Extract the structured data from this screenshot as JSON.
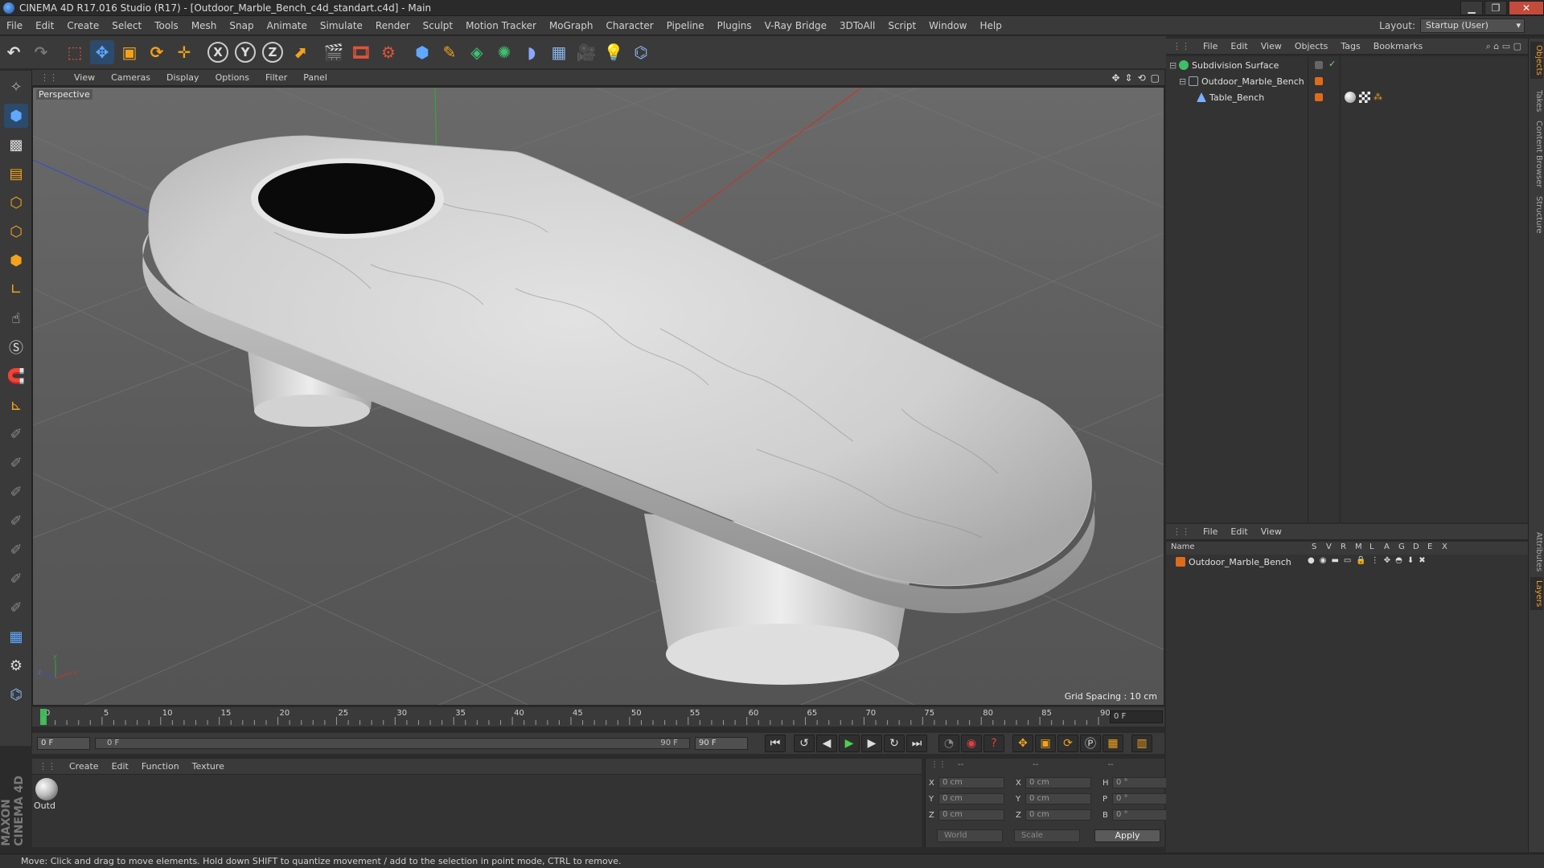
{
  "window": {
    "title": "CINEMA 4D R17.016 Studio (R17) - [Outdoor_Marble_Bench_c4d_standart.c4d] - Main"
  },
  "menubar": [
    "File",
    "Edit",
    "Create",
    "Select",
    "Tools",
    "Mesh",
    "Snap",
    "Animate",
    "Simulate",
    "Render",
    "Sculpt",
    "Motion Tracker",
    "MoGraph",
    "Character",
    "Pipeline",
    "Plugins",
    "V-Ray Bridge",
    "3DToAll",
    "Script",
    "Window",
    "Help"
  ],
  "layout": {
    "label": "Layout:",
    "value": "Startup (User)"
  },
  "toolbar": {
    "axis_x": "X",
    "axis_y": "Y",
    "axis_z": "Z"
  },
  "viewport": {
    "menu": [
      "View",
      "Cameras",
      "Display",
      "Options",
      "Filter",
      "Panel"
    ],
    "label": "Perspective",
    "grid_spacing": "Grid Spacing : 10 cm"
  },
  "timeline": {
    "ticks": [
      "0",
      "5",
      "10",
      "15",
      "20",
      "25",
      "30",
      "35",
      "40",
      "45",
      "50",
      "55",
      "60",
      "65",
      "70",
      "75",
      "80",
      "85",
      "90"
    ],
    "current_frame": "0 F",
    "start_field": "0 F",
    "range_start": "0 F",
    "range_end": "90 F",
    "end_field": "90 F"
  },
  "material_manager": {
    "menu": [
      "Create",
      "Edit",
      "Function",
      "Texture"
    ],
    "material_name": "Outd"
  },
  "coordinates": {
    "header_a": "--",
    "header_b": "--",
    "header_c": "--",
    "rows": [
      {
        "pos_axis": "X",
        "pos": "0 cm",
        "size_axis": "X",
        "size": "0 cm",
        "rot_axis": "H",
        "rot": "0 °"
      },
      {
        "pos_axis": "Y",
        "pos": "0 cm",
        "size_axis": "Y",
        "size": "0 cm",
        "rot_axis": "P",
        "rot": "0 °"
      },
      {
        "pos_axis": "Z",
        "pos": "0 cm",
        "size_axis": "Z",
        "size": "0 cm",
        "rot_axis": "B",
        "rot": "0 °"
      }
    ],
    "mode": "World",
    "scale": "Scale",
    "apply": "Apply"
  },
  "object_manager": {
    "menu": [
      "File",
      "Edit",
      "View",
      "Objects",
      "Tags",
      "Bookmarks"
    ],
    "objects": [
      {
        "name": "Subdivision Surface",
        "depth": 0
      },
      {
        "name": "Outdoor_Marble_Bench",
        "depth": 1
      },
      {
        "name": "Table_Bench",
        "depth": 2
      }
    ]
  },
  "layer_manager": {
    "menu": [
      "File",
      "Edit",
      "View"
    ],
    "columns": [
      "Name",
      "S",
      "V",
      "R",
      "M",
      "L",
      "A",
      "G",
      "D",
      "E",
      "X"
    ],
    "layers": [
      {
        "name": "Outdoor_Marble_Bench",
        "color": "#e06a1a"
      }
    ]
  },
  "side_tabs": [
    "Objects",
    "Takes",
    "Content Browser",
    "Structure",
    "Attributes",
    "Layers"
  ],
  "status": "Move: Click and drag to move elements. Hold down SHIFT to quantize movement / add to the selection in point mode, CTRL to remove.",
  "colors": {
    "accent": "#f0a030",
    "layer_orange": "#e06a1a",
    "axis_x": "#c0392b",
    "axis_y": "#3aa335",
    "axis_z": "#3a4fc0"
  }
}
